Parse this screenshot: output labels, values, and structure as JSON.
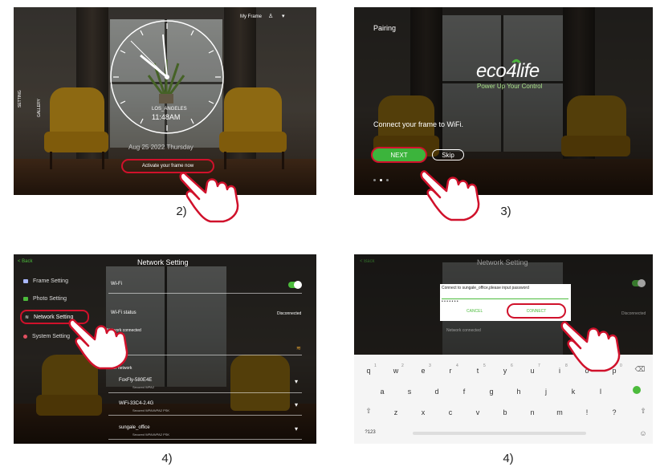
{
  "panel2": {
    "my_frame": "My Frame",
    "setting": "SETTING",
    "gallery": "GALLERY",
    "city": "LOS_ANGELES",
    "time": "11:48AM",
    "date": "Aug 25 2022 Thursday",
    "activate": "Activate your frame now",
    "caption": "2)"
  },
  "panel3": {
    "title": "Pairing",
    "logo": "eco4life",
    "tagline": "Power Up Your Control",
    "message": "Connect your frame to WiFi.",
    "next": "NEXT",
    "skip": "Skip",
    "caption": "3)"
  },
  "panel4": {
    "back": "< Back",
    "title": "Network Setting",
    "menu": [
      "Frame Setting",
      "Photo Setting",
      "Network Setting",
      "System Setting"
    ],
    "wifi": "Wi-Fi",
    "wifi_status": "Wi-Fi status",
    "status_value": "Disconnected",
    "network_connected": "Network connected",
    "other_network": "Other network",
    "networks": [
      {
        "name": "FoxFly-580E4E",
        "security": "Secured WPA2"
      },
      {
        "name": "WiFi-33C4-2.4G",
        "security": "Secured WPA/WPA2 PSK"
      },
      {
        "name": "sungale_office",
        "security": "Secured WPA/WPA2 PSK"
      }
    ],
    "caption": "4)"
  },
  "panel5": {
    "back": "< Back",
    "title": "Network Setting",
    "prompt": "Connect to sungale_office,please input password",
    "password": "• • • • • • •",
    "cancel": "CANCEL",
    "connect": "CONNECT",
    "status_value": "Disconnected",
    "network_connected": "Network connected",
    "wifi": "Wi-Fi",
    "keyboard": {
      "row1": [
        "q",
        "w",
        "e",
        "r",
        "t",
        "y",
        "u",
        "i",
        "o",
        "p"
      ],
      "row1_nums": [
        "1",
        "2",
        "3",
        "4",
        "5",
        "6",
        "7",
        "8",
        "9",
        "0"
      ],
      "row2": [
        "a",
        "s",
        "d",
        "f",
        "g",
        "h",
        "j",
        "k",
        "l"
      ],
      "row3": [
        "z",
        "x",
        "c",
        "v",
        "b",
        "n",
        "m",
        "!",
        "?"
      ],
      "symbols": "?123"
    },
    "caption": "4)"
  }
}
